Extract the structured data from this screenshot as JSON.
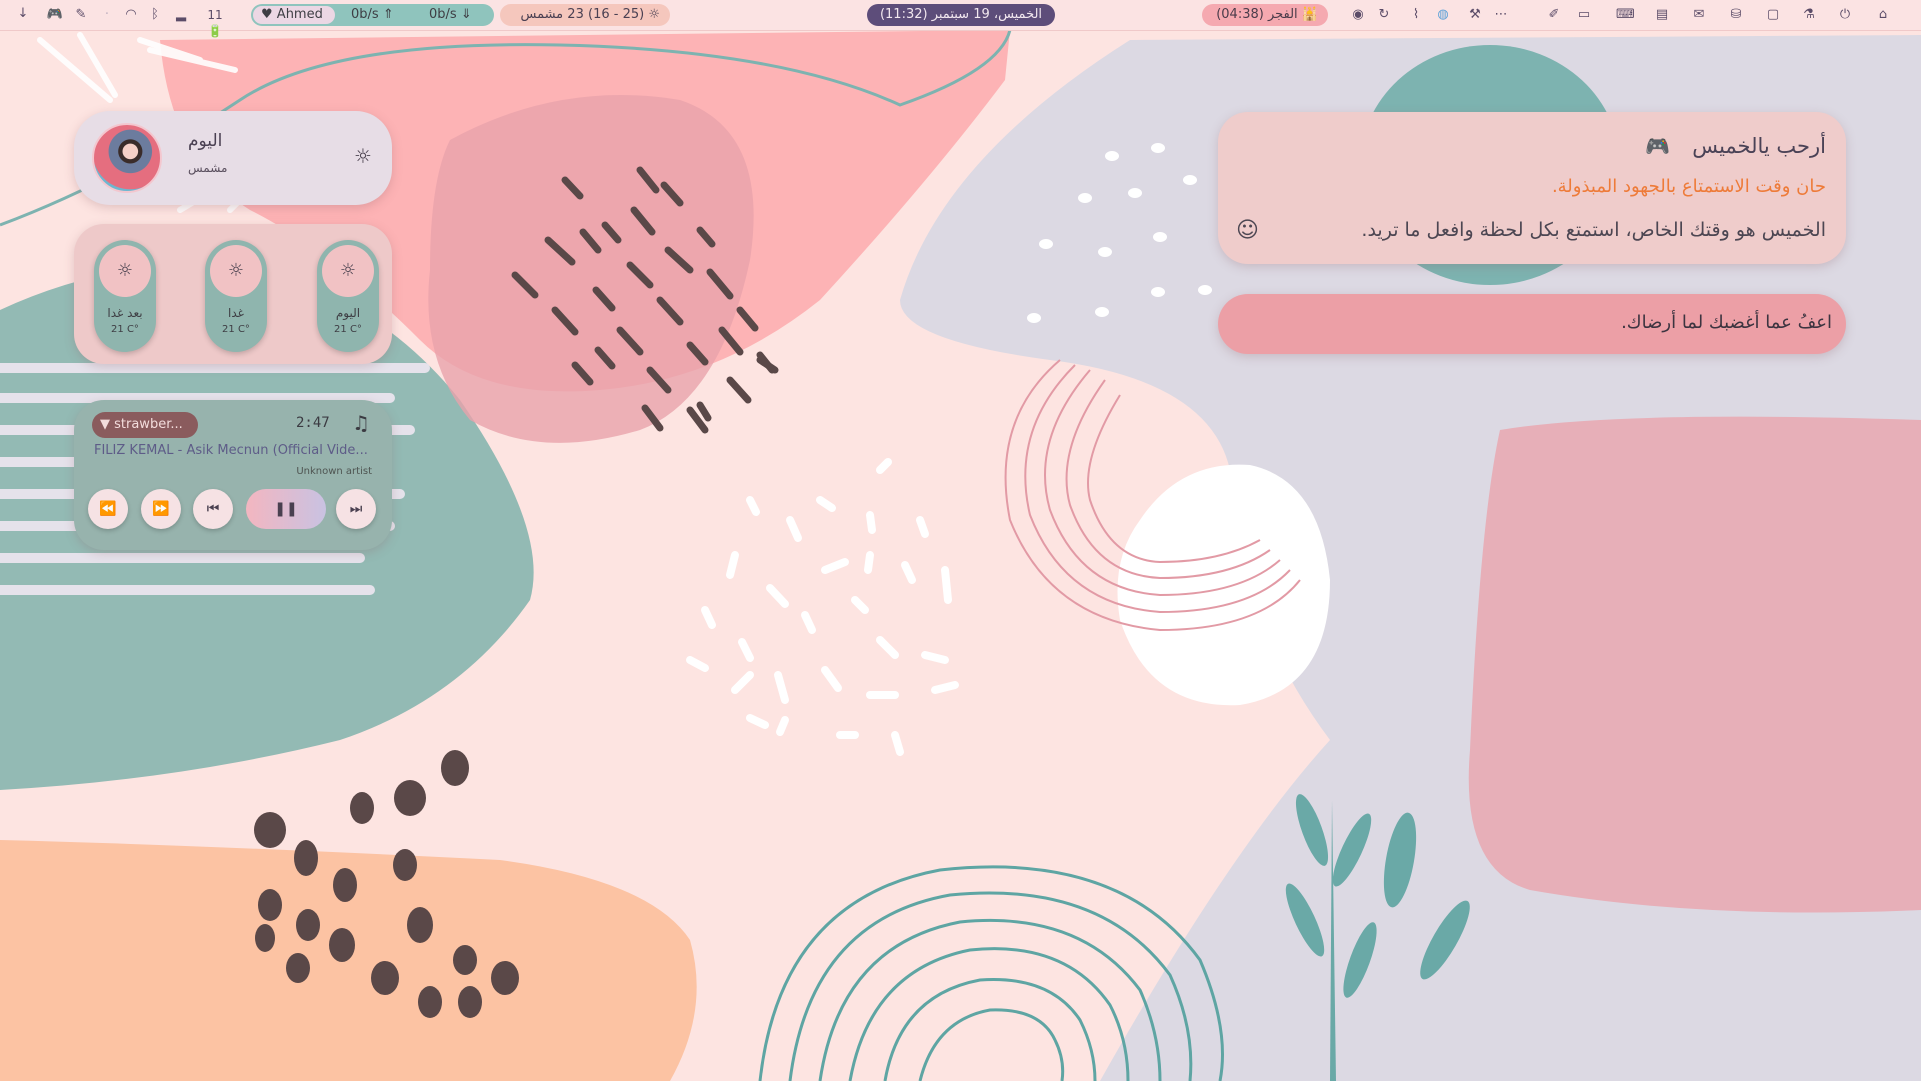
{
  "topbar": {
    "download_icon": "arrow-down-icon",
    "battery": "11",
    "user_name": "Ahmed",
    "net_down": "0b/s",
    "net_up": "0b/s",
    "weather": "(25 - 16) 23 مشمس",
    "clock": "الخميس، 19 سبتمبر (11:32)",
    "prayer": "الفجر (04:38)"
  },
  "profile": {
    "title": "اليوم",
    "subtitle": "مشمس"
  },
  "weather": {
    "days": [
      {
        "name": "بعد غدا",
        "temp": "21 C°"
      },
      {
        "name": "غدا",
        "temp": "21 C°"
      },
      {
        "name": "اليوم",
        "temp": "21 C°"
      }
    ]
  },
  "music": {
    "chip": "▼ strawber...",
    "time": "2:47",
    "title": "FILIZ KEMAL - Asik Mecnun (Official Vide...",
    "artist": "Unknown artist"
  },
  "welcome": {
    "title": "أرحب يالخميس",
    "line1": "حان وقت الاستمتاع بالجهود المبذولة.",
    "line2": "الخميس هو وقتك الخاص، استمتع بكل لحظة وافعل ما تريد."
  },
  "quote": {
    "text": "اعفُ عما أغضبك لما أرضاك."
  },
  "colors": {
    "pink": "#fdb3b5",
    "teal": "#7db3b0",
    "lavender": "#dcd9e3",
    "peach": "#fcc3a3",
    "accent_orange": "#ee7b39"
  }
}
